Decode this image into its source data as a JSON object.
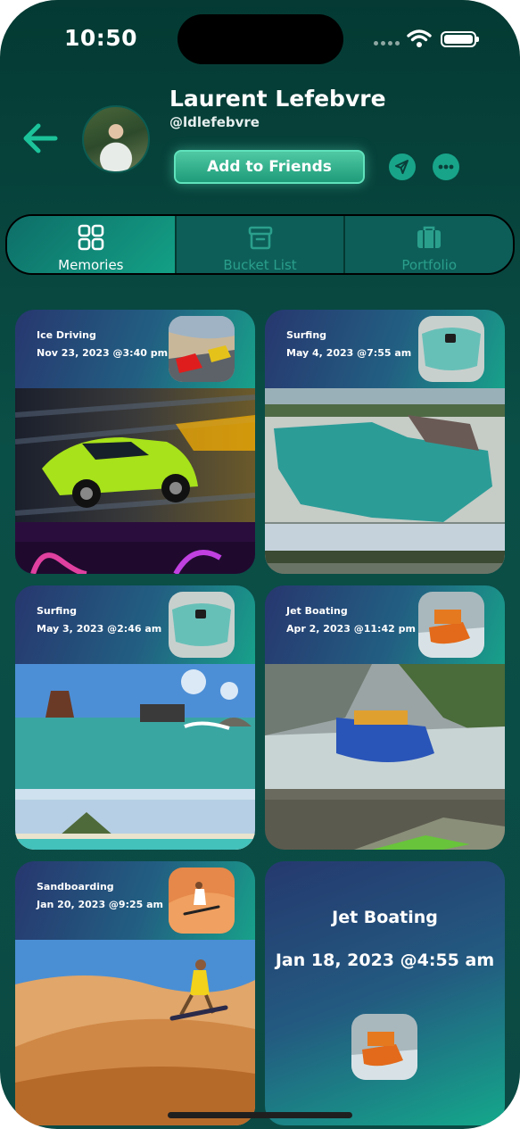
{
  "status_bar": {
    "time": "10:50"
  },
  "profile": {
    "name": "Laurent Lefebvre",
    "handle": "@ldlefebvre",
    "add_label": "Add to Friends"
  },
  "tabs": [
    {
      "label": "Memories",
      "icon": "grid-icon",
      "active": true
    },
    {
      "label": "Bucket List",
      "icon": "archive-box-icon",
      "active": false
    },
    {
      "label": "Portfolio",
      "icon": "briefcase-icon",
      "active": false
    }
  ],
  "memories": [
    {
      "title": "Ice Driving",
      "date": "Nov 23, 2023 @3:40 pm"
    },
    {
      "title": "Surfing",
      "date": "May 4, 2023 @7:55 am"
    },
    {
      "title": "Surfing",
      "date": "May 3, 2023 @2:46 am"
    },
    {
      "title": "Jet Boating",
      "date": "Apr 2, 2023 @11:42 pm"
    },
    {
      "title": "Sandboarding",
      "date": "Jan 20, 2023 @9:25 am"
    },
    {
      "title": "Jet Boating",
      "date": "Jan 18, 2023 @4:55 am"
    }
  ],
  "colors": {
    "accent": "#18a489",
    "background": "#0a4f47",
    "card_header": "#225f82"
  }
}
